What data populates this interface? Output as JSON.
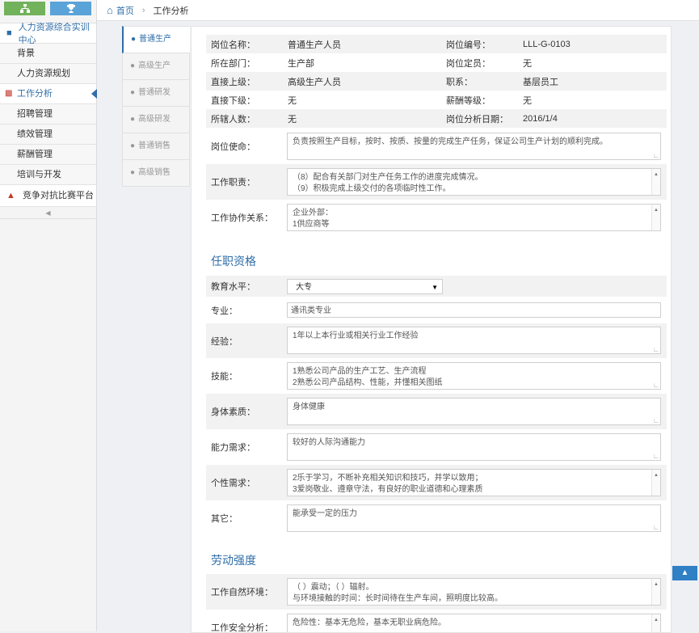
{
  "sidebar": {
    "center": "人力资源综合实训中心",
    "items": [
      {
        "label": "背景"
      },
      {
        "label": "人力资源规划"
      },
      {
        "label": "工作分析"
      },
      {
        "label": "招聘管理"
      },
      {
        "label": "绩效管理"
      },
      {
        "label": "薪酬管理"
      },
      {
        "label": "培训与开发"
      }
    ],
    "competition": "竞争对抗比赛平台"
  },
  "breadcrumb": {
    "home": "首页",
    "current": "工作分析"
  },
  "tabs": [
    "普通生产",
    "高级生产",
    "普通研发",
    "高级研发",
    "普通销售",
    "高级销售"
  ],
  "info": {
    "rows": [
      {
        "l1": "岗位名称：",
        "v1": "普通生产人员",
        "l2": "岗位编号：",
        "v2": "LLL-G-0103"
      },
      {
        "l1": "所在部门：",
        "v1": "生产部",
        "l2": "岗位定员：",
        "v2": "无"
      },
      {
        "l1": "直接上级：",
        "v1": "高级生产人员",
        "l2": "职系：",
        "v2": "基层员工"
      },
      {
        "l1": "直接下级：",
        "v1": "无",
        "l2": "薪酬等级：",
        "v2": "无"
      },
      {
        "l1": "所辖人数：",
        "v1": "无",
        "l2": "岗位分析日期：",
        "v2": "2016/1/4"
      }
    ],
    "mission_label": "岗位使命：",
    "mission": "负责按照生产目标，按时、按质、按量的完成生产任务，保证公司生产计划的顺利完成。",
    "duty_label": "工作职责：",
    "duty_line1": "（8）配合有关部门对生产任务工作的进度完成情况。",
    "duty_line2": "（9）积极完成上级交付的各项临时性工作。",
    "relation_label": "工作协作关系：",
    "relation_line1": "企业外部：",
    "relation_line2": "1供应商等"
  },
  "qualification": {
    "title": "任职资格",
    "education_label": "教育水平：",
    "education_value": "大专",
    "major_label": "专业：",
    "major_value": "通讯类专业",
    "experience_label": "经验：",
    "experience_value": "1年以上本行业或相关行业工作经验",
    "skill_label": "技能：",
    "skill_line1": "1熟悉公司产品的生产工艺、生产流程",
    "skill_line2": "2熟悉公司产品结构、性能，并懂相关图纸",
    "physical_label": "身体素质：",
    "physical_value": "身体健康",
    "ability_label": "能力需求：",
    "ability_value": "较好的人际沟通能力",
    "personality_label": "个性需求：",
    "personality_line1": "2乐于学习，不断补充相关知识和技巧，并学以致用；",
    "personality_line2": "3爱岗敬业、遵章守法，有良好的职业道德和心理素质",
    "other_label": "其它：",
    "other_value": "能承受一定的压力"
  },
  "labor": {
    "title": "劳动强度",
    "env_label": "工作自然环境：",
    "env_line1": "（ ）震动；（ ）辐射。",
    "env_line2": "与环境接触的时间：长时间待在生产车间，照明度比较高。",
    "safety_label": "工作安全分析：",
    "safety_line1": "危险性：基本无危险，基本无职业病危险。"
  }
}
